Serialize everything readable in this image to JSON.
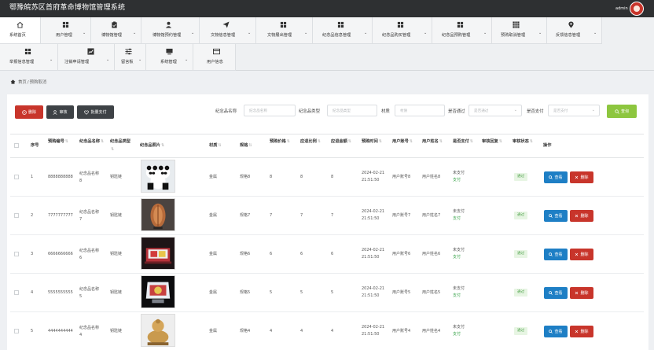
{
  "app": {
    "title": "鄂豫皖苏区首府革命博物馆管理系统",
    "user": "admin"
  },
  "nav": [
    {
      "label": "系统首页",
      "icon": "home-icon"
    },
    {
      "label": "用户管理",
      "icon": "grid-icon"
    },
    {
      "label": "博物馆管理",
      "icon": "clipboard-icon"
    },
    {
      "label": "博物馆预约管理",
      "icon": "user-icon"
    },
    {
      "label": "文物信息管理",
      "icon": "send-icon"
    },
    {
      "label": "文物展出管理",
      "icon": "grid-icon"
    },
    {
      "label": "纪念品信息管理",
      "icon": "grid-icon"
    },
    {
      "label": "纪念品购买管理",
      "icon": "grid-icon"
    },
    {
      "label": "纪念品预购管理",
      "icon": "grid-icon"
    },
    {
      "label": "预购取消管理",
      "icon": "apps-icon"
    },
    {
      "label": "反馈信息管理",
      "icon": "pin-icon"
    },
    {
      "label": "举报信息管理",
      "icon": "grid-icon"
    },
    {
      "label": "注销申请管理",
      "icon": "chart-icon"
    },
    {
      "label": "留言板",
      "icon": "sliders-icon"
    },
    {
      "label": "系统管理",
      "icon": "monitor-icon"
    },
    {
      "label": "用户信息",
      "icon": "card-icon"
    }
  ],
  "breadcrumb": {
    "home": "首页",
    "sep": "/",
    "current": "预购取消"
  },
  "toolbar": {
    "delete": "删除",
    "audit": "审核",
    "batch_pay": "批量支付",
    "filters": [
      {
        "label": "纪念品名称",
        "placeholder": "纪念品名称",
        "type": "text"
      },
      {
        "label": "纪念品类型",
        "placeholder": "纪念品类型",
        "type": "text"
      },
      {
        "label": "材质",
        "placeholder": "材质",
        "type": "text"
      },
      {
        "label": "是否通过",
        "placeholder": "是否通过",
        "type": "select"
      },
      {
        "label": "是否支付",
        "placeholder": "是否支付",
        "type": "select"
      }
    ],
    "query": "查询"
  },
  "table": {
    "headers": {
      "no": "序号",
      "code": "预购编号",
      "name": "纪念品名称",
      "type": "纪念品类型",
      "photo": "纪念品照片",
      "material": "材质",
      "spec": "规格",
      "price": "预购价格",
      "ratio": "应退比例",
      "refund": "应退金额",
      "time": "预购时间",
      "account": "用户账号",
      "uname": "用户姓名",
      "paid": "是否支付",
      "reply": "审核回复",
      "status": "审核状态",
      "ops": "操作"
    },
    "rows": [
      {
        "no": "1",
        "code": "8888888888",
        "name": "纪念品名称8",
        "type": "钥匙链",
        "material": "金属",
        "spec": "规格8",
        "price": "8",
        "ratio": "8",
        "refund": "8",
        "date": "2024-02-21",
        "clock": "21:51:50",
        "account": "用户账号8",
        "uname": "用户姓名8",
        "paid": "未支付",
        "pay": "支付",
        "status": "通过",
        "view": "查看",
        "del": "删除"
      },
      {
        "no": "2",
        "code": "7777777777",
        "name": "纪念品名称7",
        "type": "钥匙链",
        "material": "金属",
        "spec": "规格7",
        "price": "7",
        "ratio": "7",
        "refund": "7",
        "date": "2024-02-21",
        "clock": "21:51:50",
        "account": "用户账号7",
        "uname": "用户姓名7",
        "paid": "未支付",
        "pay": "支付",
        "status": "通过",
        "view": "查看",
        "del": "删除"
      },
      {
        "no": "3",
        "code": "6666666666",
        "name": "纪念品名称6",
        "type": "钥匙链",
        "material": "金属",
        "spec": "规格6",
        "price": "6",
        "ratio": "6",
        "refund": "6",
        "date": "2024-02-21",
        "clock": "21:51:50",
        "account": "用户账号6",
        "uname": "用户姓名6",
        "paid": "未支付",
        "pay": "支付",
        "status": "通过",
        "view": "查看",
        "del": "删除"
      },
      {
        "no": "4",
        "code": "5555555555",
        "name": "纪念品名称5",
        "type": "钥匙链",
        "material": "金属",
        "spec": "规格5",
        "price": "5",
        "ratio": "5",
        "refund": "5",
        "date": "2024-02-21",
        "clock": "21:51:50",
        "account": "用户账号5",
        "uname": "用户姓名5",
        "paid": "未支付",
        "pay": "支付",
        "status": "通过",
        "view": "查看",
        "del": "删除"
      },
      {
        "no": "5",
        "code": "4444444444",
        "name": "纪念品名称4",
        "type": "钥匙链",
        "material": "金属",
        "spec": "规格4",
        "price": "4",
        "ratio": "4",
        "refund": "4",
        "date": "2024-02-21",
        "clock": "21:51:50",
        "account": "用户账号4",
        "uname": "用户姓名4",
        "paid": "未支付",
        "pay": "支付",
        "status": "通过",
        "view": "查看",
        "del": "删除"
      }
    ]
  }
}
